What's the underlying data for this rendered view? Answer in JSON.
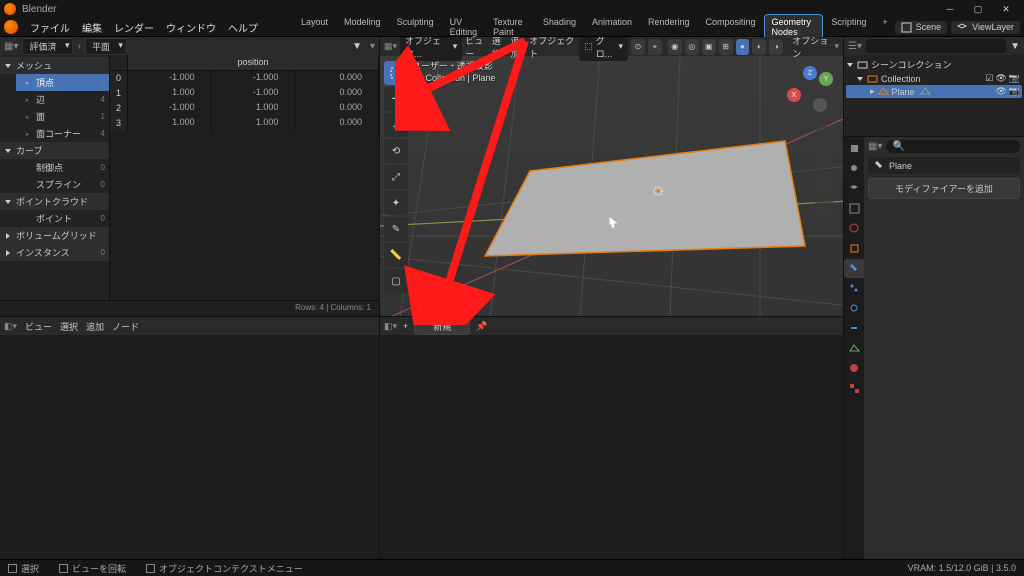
{
  "app": {
    "title": "Blender"
  },
  "menu": [
    "ファイル",
    "編集",
    "レンダー",
    "ウィンドウ",
    "ヘルプ"
  ],
  "workspaces": [
    "Layout",
    "Modeling",
    "Sculpting",
    "UV Editing",
    "Texture Paint",
    "Shading",
    "Animation",
    "Rendering",
    "Compositing",
    "Geometry Nodes",
    "Scripting"
  ],
  "workspace_active": 9,
  "scene": {
    "scene_label": "Scene",
    "layer_label": "ViewLayer"
  },
  "spreadsheet": {
    "object_pill": "評価済",
    "geom_pill": "平面",
    "domain_head": "メッシュ",
    "domains": [
      {
        "label": "頂点",
        "count": "4",
        "sel": true
      },
      {
        "label": "辺",
        "count": "4"
      },
      {
        "label": "面",
        "count": "1"
      },
      {
        "label": "面コーナー",
        "count": "4"
      }
    ],
    "groups": [
      {
        "head": "カーブ",
        "items": [
          {
            "label": "制御点",
            "count": "0"
          },
          {
            "label": "スプライン",
            "count": "0"
          }
        ]
      },
      {
        "head": "ポイントクラウド",
        "items": [
          {
            "label": "ポイント",
            "count": "0"
          }
        ]
      },
      {
        "head": "ボリュームグリッド",
        "items": []
      },
      {
        "head": "インスタンス",
        "count": "0"
      }
    ],
    "col": "position",
    "rows": [
      {
        "i": "0",
        "v": [
          "-1.000",
          "-1.000",
          "0.000"
        ]
      },
      {
        "i": "1",
        "v": [
          "1.000",
          "-1.000",
          "0.000"
        ]
      },
      {
        "i": "2",
        "v": [
          "-1.000",
          "1.000",
          "0.000"
        ]
      },
      {
        "i": "3",
        "v": [
          "1.000",
          "1.000",
          "0.000"
        ]
      }
    ],
    "status": "Rows: 4  |  Columns: 1"
  },
  "nodepanel": {
    "menus": [
      "ビュー",
      "選択",
      "追加",
      "ノード"
    ]
  },
  "viewport": {
    "mode": "オブジェク...",
    "menus": [
      "ビュー",
      "選択",
      "追加",
      "オブジェクト"
    ],
    "transform": "グロ...",
    "options": "オプション",
    "overlay": {
      "l1": "ユーザー・透視投影",
      "l2": "(1) Collection | Plane"
    }
  },
  "nodepanel2": {
    "new_btn": "新規"
  },
  "outliner": {
    "root": "シーンコレクション",
    "coll": "Collection",
    "obj": "Plane"
  },
  "props": {
    "obj_name": "Plane",
    "add_modifier": "モディファイアーを追加",
    "search_ph": ""
  },
  "status": {
    "select": "選択",
    "rotview": "ビューを回転",
    "ctxmenu": "オブジェクトコンテクストメニュー",
    "vram": "VRAM: 1.5/12.0 GiB | 3.5.0"
  }
}
